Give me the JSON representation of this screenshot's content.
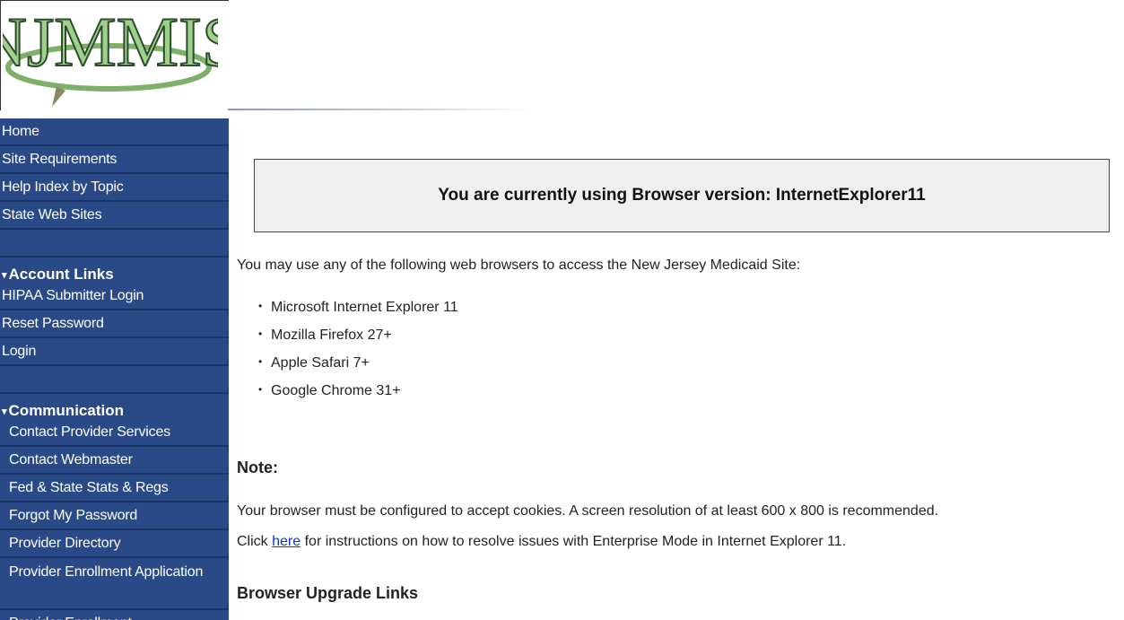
{
  "logo": {
    "text": "NJMMIS",
    "colors": {
      "letters": "#9fd08a",
      "outline": "#2c4a2c",
      "swoosh": "#7fb069"
    }
  },
  "sidebar": {
    "colors": {
      "background": "#294a86",
      "border": "#1a3366",
      "text": "#ffffff"
    },
    "top_items": [
      "Home",
      "Site Requirements",
      "Help Index by Topic",
      "State Web Sites"
    ],
    "account_section": {
      "label": "Account Links",
      "items": [
        "HIPAA Submitter Login",
        "Reset Password",
        "Login"
      ]
    },
    "communication_section": {
      "label": "Communication",
      "items": [
        "Contact Provider Services",
        "Contact Webmaster",
        "Fed & State Stats & Regs",
        "Forgot My Password",
        "Provider Directory",
        "Provider Enrollment Application",
        "Provider Enrollment"
      ]
    }
  },
  "main": {
    "browser_version_text": "You are currently using Browser version: InternetExplorer11",
    "intro": "You may use any of the following web browsers to access the New Jersey Medicaid Site:",
    "browsers": [
      "Microsoft Internet Explorer 11",
      "Mozilla Firefox 27+",
      "Apple Safari 7+",
      "Google Chrome 31+"
    ],
    "note_heading": "Note:",
    "note_text": "Your browser must be configured to accept cookies. A screen resolution of at least 600 x 800 is recommended.",
    "click_prefix": "Click",
    "click_link": "here",
    "click_suffix": " for instructions on how to resolve issues with Enterprise Mode in Internet Explorer 11.",
    "upgrade_heading": "Browser Upgrade Links"
  }
}
